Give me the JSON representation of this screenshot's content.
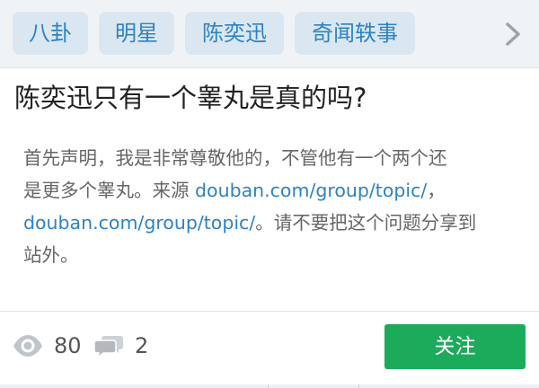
{
  "topic_tags": [
    "八卦",
    "明星",
    "陈奕迅",
    "奇闻轶事"
  ],
  "question": {
    "title": "陈奕迅只有一个睾丸是真的吗?",
    "description": {
      "line1": "首先声明，我是非常尊敬他的，不管他有一个两个还",
      "line2_text": "是更多个睾丸。来源 ",
      "link1": "douban.com/group/topic/",
      "line2_end": "，",
      "link2": "douban.com/group/topic/",
      "line3_text": "。请不要把这个问题分享到",
      "line4": "站外。"
    }
  },
  "stats": {
    "views": "80",
    "comments": "2"
  },
  "follow_button": "关注",
  "icons": {
    "more": "chevron-right-icon",
    "views": "eye-icon",
    "comments": "speech-bubbles-icon"
  },
  "colors": {
    "accent": "#2e82c4",
    "follow": "#1bab5b",
    "tag_bg": "#dbe7f0"
  }
}
